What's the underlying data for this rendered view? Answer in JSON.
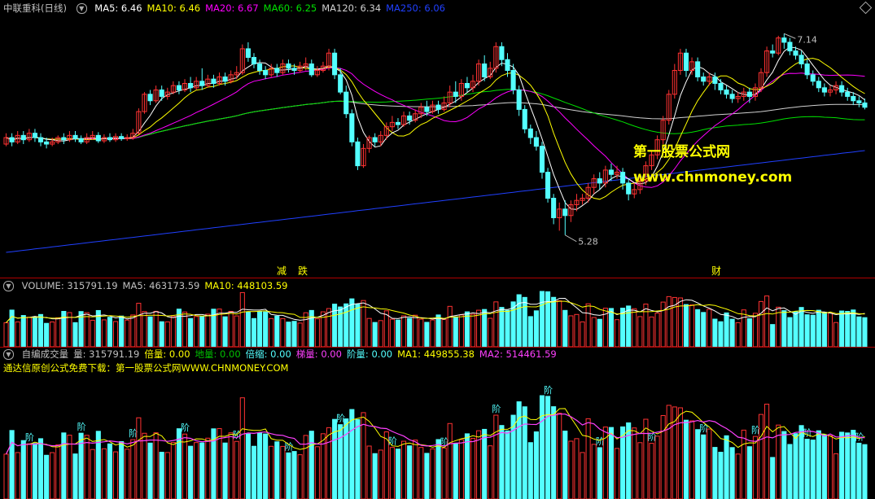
{
  "colors": {
    "up": "#ff3232",
    "down": "#54ffff",
    "ma5": "#ffffff",
    "ma10": "#ffff00",
    "ma20": "#ff00ff",
    "ma60": "#00e000",
    "ma120": "#d0d0d0",
    "ma250": "#2040ff",
    "bei": "#ffff00",
    "tag": "#ff40ff",
    "watermark": "#ffff00"
  },
  "main": {
    "title": "中联重科(日线)",
    "legend": [
      {
        "label": "MA5: 6.46",
        "color": "#ffffff"
      },
      {
        "label": "MA10: 6.46",
        "color": "#ffff00"
      },
      {
        "label": "MA20: 6.67",
        "color": "#ff00ff"
      },
      {
        "label": "MA60: 6.25",
        "color": "#00e000"
      },
      {
        "label": "MA120: 6.34",
        "color": "#d0d0d0"
      },
      {
        "label": "MA250: 6.06",
        "color": "#2040ff"
      }
    ],
    "high_label": "7.14",
    "low_label": "5.28",
    "watermark_cn": "第一股票公式网",
    "watermark_url": "www.chnmoney.com",
    "bottom_marks": [
      "减",
      "跌",
      "财"
    ]
  },
  "volume": {
    "legend": [
      {
        "label": "VOLUME: 315791.19",
        "color": "#c0c0c0"
      },
      {
        "label": "MA5: 463173.59",
        "color": "#c0c0c0"
      },
      {
        "label": "MA10: 448103.59",
        "color": "#ffff00"
      }
    ]
  },
  "indicator": {
    "legend": [
      {
        "label": "自编成交量",
        "color": "#c0c0c0"
      },
      {
        "label": "量: 315791.19",
        "color": "#c0c0c0"
      },
      {
        "label": "倍量: 0.00",
        "color": "#ffff00"
      },
      {
        "label": "地量: 0.00",
        "color": "#00c000"
      },
      {
        "label": "倍缩: 0.00",
        "color": "#54ffff"
      },
      {
        "label": "梯量: 0.00",
        "color": "#ff40ff"
      },
      {
        "label": "阶量: 0.00",
        "color": "#54ffff"
      },
      {
        "label": "MA1: 449855.38",
        "color": "#ffff00"
      },
      {
        "label": "MA2: 514461.59",
        "color": "#ff40ff"
      }
    ],
    "note": "通达信原创公式免费下载：第一股票公式网WWW.CHNMONEY.COM",
    "tag_bei": "倍",
    "tag_jie": "阶",
    "tag_suo": "缩",
    "tag_ti": "梯"
  },
  "chart_data": [
    {
      "type": "candlestick",
      "title": "中联重科(日线)",
      "ylim": [
        5.0,
        7.3
      ],
      "annotations": [
        {
          "text": "7.14",
          "value": 7.14
        },
        {
          "text": "5.28",
          "value": 5.28
        }
      ],
      "series": [
        {
          "name": "MA5",
          "last": 6.46
        },
        {
          "name": "MA10",
          "last": 6.46
        },
        {
          "name": "MA20",
          "last": 6.67
        },
        {
          "name": "MA60",
          "last": 6.25
        },
        {
          "name": "MA120",
          "last": 6.34
        },
        {
          "name": "MA250",
          "last": 6.06
        }
      ],
      "candles": [
        [
          6.12,
          6.18,
          6.22,
          6.1
        ],
        [
          6.18,
          6.14,
          6.22,
          6.1
        ],
        [
          6.14,
          6.2,
          6.24,
          6.12
        ],
        [
          6.2,
          6.16,
          6.24,
          6.12
        ],
        [
          6.16,
          6.22,
          6.26,
          6.14
        ],
        [
          6.22,
          6.18,
          6.26,
          6.14
        ],
        [
          6.18,
          6.14,
          6.22,
          6.1
        ],
        [
          6.14,
          6.12,
          6.18,
          6.08
        ],
        [
          6.12,
          6.14,
          6.18,
          6.1
        ],
        [
          6.14,
          6.18,
          6.2,
          6.12
        ],
        [
          6.18,
          6.16,
          6.22,
          6.12
        ],
        [
          6.16,
          6.2,
          6.24,
          6.14
        ],
        [
          6.2,
          6.17,
          6.24,
          6.14
        ],
        [
          6.17,
          6.14,
          6.2,
          6.12
        ],
        [
          6.14,
          6.18,
          6.22,
          6.12
        ],
        [
          6.18,
          6.2,
          6.24,
          6.16
        ],
        [
          6.2,
          6.15,
          6.23,
          6.13
        ],
        [
          6.15,
          6.18,
          6.21,
          6.13
        ],
        [
          6.18,
          6.16,
          6.22,
          6.14
        ],
        [
          6.16,
          6.19,
          6.22,
          6.14
        ],
        [
          6.19,
          6.17,
          6.22,
          6.15
        ],
        [
          6.17,
          6.18,
          6.21,
          6.15
        ],
        [
          6.18,
          6.22,
          6.26,
          6.16
        ],
        [
          6.22,
          6.42,
          6.45,
          6.21
        ],
        [
          6.42,
          6.58,
          6.6,
          6.4
        ],
        [
          6.58,
          6.52,
          6.62,
          6.48
        ],
        [
          6.52,
          6.62,
          6.66,
          6.5
        ],
        [
          6.62,
          6.56,
          6.66,
          6.52
        ],
        [
          6.56,
          6.6,
          6.64,
          6.53
        ],
        [
          6.6,
          6.66,
          6.7,
          6.58
        ],
        [
          6.66,
          6.62,
          6.7,
          6.58
        ],
        [
          6.62,
          6.68,
          6.72,
          6.6
        ],
        [
          6.68,
          6.64,
          6.74,
          6.6
        ],
        [
          6.64,
          6.7,
          6.74,
          6.62
        ],
        [
          6.7,
          6.66,
          6.82,
          6.62
        ],
        [
          6.66,
          6.72,
          6.76,
          6.64
        ],
        [
          6.72,
          6.68,
          6.76,
          6.64
        ],
        [
          6.68,
          6.74,
          6.78,
          6.66
        ],
        [
          6.74,
          6.7,
          6.78,
          6.66
        ],
        [
          6.7,
          6.76,
          6.8,
          6.68
        ],
        [
          6.76,
          6.78,
          6.84,
          6.72
        ],
        [
          6.78,
          7.0,
          7.04,
          6.76
        ],
        [
          7.0,
          6.92,
          7.06,
          6.88
        ],
        [
          6.92,
          6.86,
          6.96,
          6.82
        ],
        [
          6.86,
          6.8,
          6.9,
          6.76
        ],
        [
          6.8,
          6.76,
          6.84,
          6.72
        ],
        [
          6.76,
          6.82,
          6.86,
          6.74
        ],
        [
          6.82,
          6.78,
          6.86,
          6.74
        ],
        [
          6.78,
          6.86,
          6.9,
          6.76
        ],
        [
          6.86,
          6.82,
          6.9,
          6.78
        ],
        [
          6.82,
          6.8,
          6.86,
          6.76
        ],
        [
          6.8,
          6.84,
          6.88,
          6.78
        ],
        [
          6.84,
          6.86,
          6.92,
          6.8
        ],
        [
          6.86,
          6.76,
          6.9,
          6.74
        ],
        [
          6.76,
          6.8,
          6.84,
          6.74
        ],
        [
          6.8,
          6.84,
          6.88,
          6.78
        ],
        [
          6.84,
          6.96,
          7.0,
          6.8
        ],
        [
          6.96,
          6.76,
          7.0,
          6.72
        ],
        [
          6.76,
          6.6,
          6.82,
          6.58
        ],
        [
          6.6,
          6.4,
          6.66,
          6.36
        ],
        [
          6.4,
          6.14,
          6.44,
          6.1
        ],
        [
          6.14,
          5.92,
          6.18,
          5.88
        ],
        [
          5.92,
          6.08,
          6.12,
          5.9
        ],
        [
          6.08,
          6.18,
          6.2,
          6.04
        ],
        [
          6.18,
          6.14,
          6.22,
          6.1
        ],
        [
          6.14,
          6.2,
          6.24,
          6.1
        ],
        [
          6.2,
          6.28,
          6.32,
          6.16
        ],
        [
          6.28,
          6.32,
          6.38,
          6.24
        ],
        [
          6.32,
          6.3,
          6.36,
          6.26
        ],
        [
          6.3,
          6.38,
          6.42,
          6.28
        ],
        [
          6.38,
          6.34,
          6.42,
          6.3
        ],
        [
          6.34,
          6.4,
          6.44,
          6.32
        ],
        [
          6.4,
          6.46,
          6.5,
          6.36
        ],
        [
          6.46,
          6.42,
          6.52,
          6.38
        ],
        [
          6.42,
          6.48,
          6.52,
          6.4
        ],
        [
          6.48,
          6.44,
          6.52,
          6.4
        ],
        [
          6.44,
          6.5,
          6.56,
          6.42
        ],
        [
          6.5,
          6.6,
          6.66,
          6.46
        ],
        [
          6.6,
          6.56,
          6.7,
          6.5
        ],
        [
          6.56,
          6.68,
          6.72,
          6.52
        ],
        [
          6.68,
          6.64,
          6.74,
          6.6
        ],
        [
          6.64,
          6.7,
          6.76,
          6.6
        ],
        [
          6.7,
          6.86,
          6.9,
          6.66
        ],
        [
          6.86,
          6.74,
          6.94,
          6.7
        ],
        [
          6.74,
          6.82,
          6.88,
          6.72
        ],
        [
          6.82,
          7.02,
          7.06,
          6.78
        ],
        [
          7.02,
          6.9,
          7.06,
          6.84
        ],
        [
          6.9,
          6.8,
          6.96,
          6.74
        ],
        [
          6.8,
          6.62,
          6.86,
          6.58
        ],
        [
          6.62,
          6.44,
          6.66,
          6.38
        ],
        [
          6.44,
          6.26,
          6.48,
          6.22
        ],
        [
          6.26,
          6.18,
          6.3,
          6.12
        ],
        [
          6.18,
          6.1,
          6.24,
          6.06
        ],
        [
          6.1,
          5.86,
          6.14,
          5.8
        ],
        [
          5.86,
          5.62,
          5.9,
          5.58
        ],
        [
          5.62,
          5.44,
          5.66,
          5.38
        ],
        [
          5.44,
          5.52,
          5.58,
          5.32
        ],
        [
          5.52,
          5.46,
          5.6,
          5.28
        ],
        [
          5.46,
          5.56,
          5.6,
          5.4
        ],
        [
          5.56,
          5.6,
          5.66,
          5.5
        ],
        [
          5.6,
          5.62,
          5.66,
          5.56
        ],
        [
          5.62,
          5.72,
          5.76,
          5.58
        ],
        [
          5.72,
          5.8,
          5.84,
          5.66
        ],
        [
          5.8,
          5.76,
          5.86,
          5.7
        ],
        [
          5.76,
          5.88,
          5.92,
          5.72
        ],
        [
          5.88,
          5.84,
          5.94,
          5.78
        ],
        [
          5.84,
          5.86,
          5.92,
          5.8
        ],
        [
          5.86,
          5.76,
          5.9,
          5.7
        ],
        [
          5.76,
          5.66,
          5.8,
          5.6
        ],
        [
          5.66,
          5.7,
          5.76,
          5.62
        ],
        [
          5.7,
          5.78,
          5.82,
          5.66
        ],
        [
          5.78,
          5.92,
          5.96,
          5.74
        ],
        [
          5.92,
          6.02,
          6.06,
          5.88
        ],
        [
          6.02,
          6.16,
          6.2,
          5.98
        ],
        [
          6.16,
          6.34,
          6.38,
          6.12
        ],
        [
          6.34,
          6.58,
          6.62,
          6.3
        ],
        [
          6.58,
          6.8,
          6.86,
          6.54
        ],
        [
          6.8,
          6.96,
          7.0,
          6.76
        ],
        [
          6.96,
          6.8,
          7.0,
          6.74
        ],
        [
          6.8,
          6.88,
          6.92,
          6.76
        ],
        [
          6.88,
          6.74,
          6.92,
          6.7
        ],
        [
          6.74,
          6.7,
          6.78,
          6.66
        ],
        [
          6.7,
          6.74,
          6.78,
          6.66
        ],
        [
          6.74,
          6.68,
          6.78,
          6.62
        ],
        [
          6.68,
          6.62,
          6.72,
          6.58
        ],
        [
          6.62,
          6.58,
          6.66,
          6.54
        ],
        [
          6.58,
          6.54,
          6.62,
          6.5
        ],
        [
          6.54,
          6.56,
          6.6,
          6.5
        ],
        [
          6.56,
          6.6,
          6.64,
          6.52
        ],
        [
          6.6,
          6.56,
          6.64,
          6.5
        ],
        [
          6.56,
          6.64,
          6.68,
          6.52
        ],
        [
          6.64,
          6.78,
          6.82,
          6.6
        ],
        [
          6.78,
          6.98,
          7.02,
          6.74
        ],
        [
          6.98,
          6.96,
          7.04,
          6.92
        ],
        [
          6.96,
          7.1,
          7.12,
          6.94
        ],
        [
          7.1,
          7.06,
          7.14,
          7.0
        ],
        [
          7.06,
          6.98,
          7.1,
          6.94
        ],
        [
          6.98,
          6.94,
          7.02,
          6.9
        ],
        [
          6.94,
          6.86,
          6.98,
          6.82
        ],
        [
          6.86,
          6.76,
          6.9,
          6.72
        ],
        [
          6.76,
          6.7,
          6.8,
          6.66
        ],
        [
          6.7,
          6.64,
          6.74,
          6.6
        ],
        [
          6.64,
          6.6,
          6.68,
          6.56
        ],
        [
          6.6,
          6.62,
          6.66,
          6.56
        ],
        [
          6.62,
          6.66,
          6.7,
          6.58
        ],
        [
          6.66,
          6.6,
          6.7,
          6.56
        ],
        [
          6.6,
          6.56,
          6.64,
          6.52
        ],
        [
          6.56,
          6.52,
          6.6,
          6.48
        ],
        [
          6.52,
          6.5,
          6.56,
          6.46
        ],
        [
          6.5,
          6.46,
          6.54,
          6.44
        ]
      ]
    },
    {
      "type": "bar",
      "title": "VOLUME",
      "series": [
        {
          "name": "VOLUME",
          "last": 315791.19
        },
        {
          "name": "MA5",
          "last": 463173.59
        },
        {
          "name": "MA10",
          "last": 448103.59
        }
      ]
    },
    {
      "type": "bar",
      "title": "自编成交量",
      "series": [
        {
          "name": "量",
          "last": 315791.19
        },
        {
          "name": "倍量",
          "last": 0.0
        },
        {
          "name": "地量",
          "last": 0.0
        },
        {
          "name": "倍缩",
          "last": 0.0
        },
        {
          "name": "梯量",
          "last": 0.0
        },
        {
          "name": "阶量",
          "last": 0.0
        },
        {
          "name": "MA1",
          "last": 449855.38
        },
        {
          "name": "MA2",
          "last": 514461.59
        }
      ]
    }
  ]
}
